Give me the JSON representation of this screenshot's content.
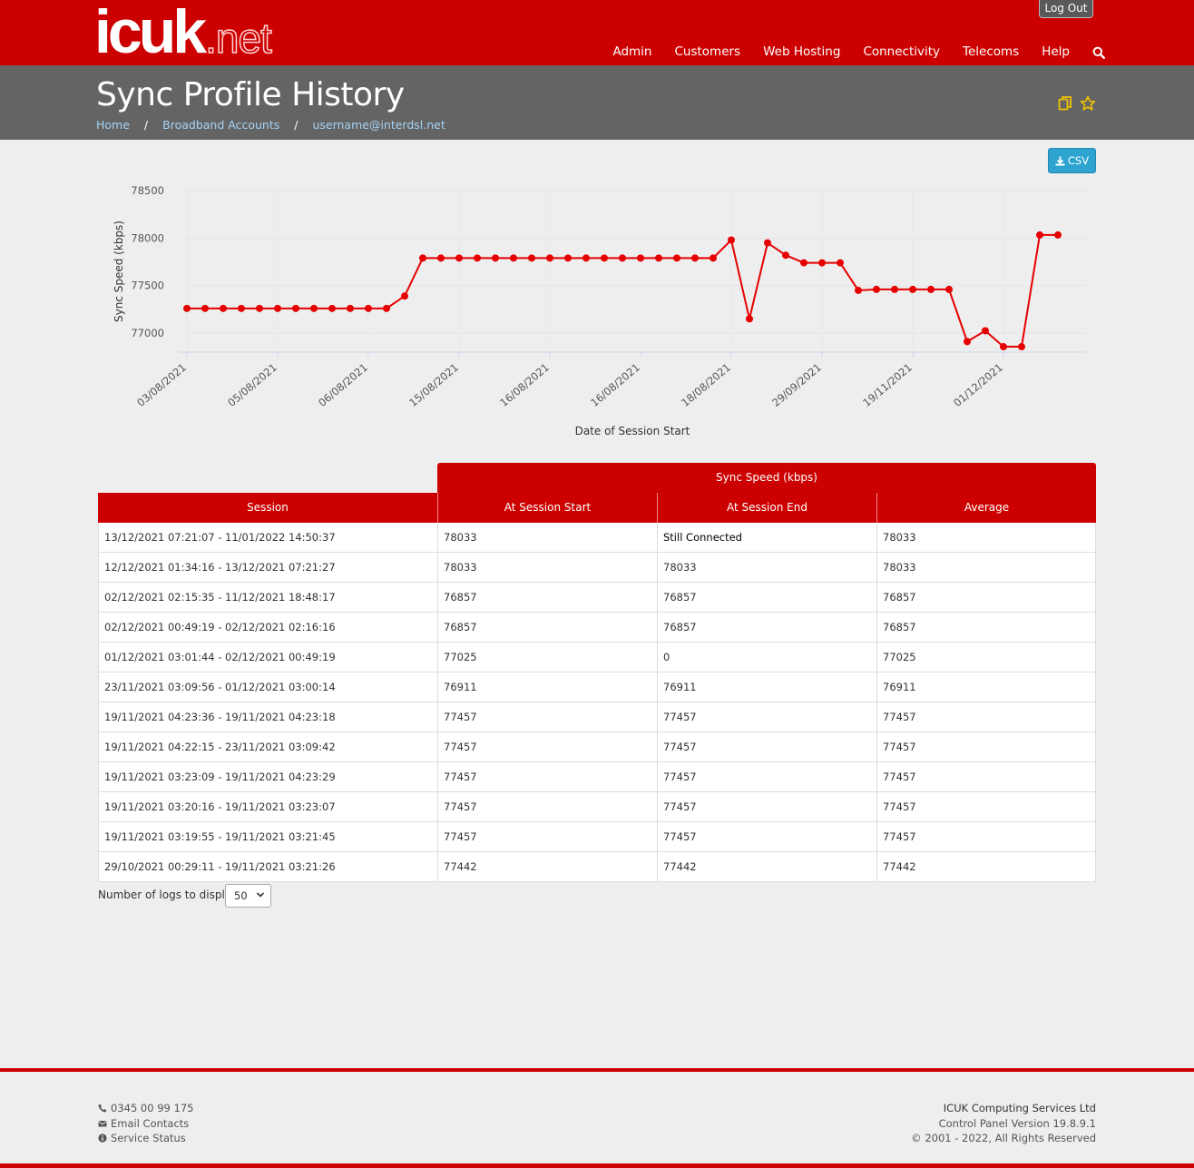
{
  "header": {
    "logo_main": "icuk",
    "logo_ext": ".net",
    "logout_label": "Log Out",
    "nav": [
      "Admin",
      "Customers",
      "Web Hosting",
      "Connectivity",
      "Telecoms",
      "Help"
    ]
  },
  "page": {
    "title": "Sync Profile History",
    "breadcrumb": [
      "Home",
      "Broadband Accounts",
      "username@interdsl.net"
    ],
    "breadcrumb_sep": "/",
    "csv_label": "CSV"
  },
  "chart_data": {
    "type": "line",
    "title": "",
    "xlabel": "Date of Session Start",
    "ylabel": "Sync Speed (kbps)",
    "ylim": [
      76800,
      78500
    ],
    "yticks": [
      77000,
      77500,
      78000,
      78500
    ],
    "xtick_labels": [
      "03/08/2021",
      "05/08/2021",
      "06/08/2021",
      "15/08/2021",
      "16/08/2021",
      "16/08/2021",
      "18/08/2021",
      "29/09/2021",
      "19/11/2021",
      "01/12/2021"
    ],
    "color": "#e60000",
    "grid": true,
    "values": [
      77260,
      77260,
      77260,
      77260,
      77260,
      77260,
      77260,
      77260,
      77260,
      77260,
      77260,
      77260,
      77390,
      77790,
      77790,
      77790,
      77790,
      77790,
      77790,
      77790,
      77790,
      77790,
      77790,
      77790,
      77790,
      77790,
      77790,
      77790,
      77790,
      77790,
      77980,
      77150,
      77950,
      77820,
      77740,
      77740,
      77740,
      77450,
      77460,
      77460,
      77460,
      77460,
      77460,
      76911,
      77025,
      76857,
      76857,
      78033,
      78033
    ]
  },
  "table": {
    "group_header": "Sync Speed (kbps)",
    "columns": [
      "Session",
      "At Session Start",
      "At Session End",
      "Average"
    ],
    "rows": [
      [
        "13/12/2021 07:21:07 - 11/01/2022 14:50:37",
        "78033",
        "Still Connected",
        "78033"
      ],
      [
        "12/12/2021 01:34:16 - 13/12/2021 07:21:27",
        "78033",
        "78033",
        "78033"
      ],
      [
        "02/12/2021 02:15:35 - 11/12/2021 18:48:17",
        "76857",
        "76857",
        "76857"
      ],
      [
        "02/12/2021 00:49:19 - 02/12/2021 02:16:16",
        "76857",
        "76857",
        "76857"
      ],
      [
        "01/12/2021 03:01:44 - 02/12/2021 00:49:19",
        "77025",
        "0",
        "77025"
      ],
      [
        "23/11/2021 03:09:56 - 01/12/2021 03:00:14",
        "76911",
        "76911",
        "76911"
      ],
      [
        "19/11/2021 04:23:36 - 19/11/2021 04:23:18",
        "77457",
        "77457",
        "77457"
      ],
      [
        "19/11/2021 04:22:15 - 23/11/2021 03:09:42",
        "77457",
        "77457",
        "77457"
      ],
      [
        "19/11/2021 03:23:09 - 19/11/2021 04:23:29",
        "77457",
        "77457",
        "77457"
      ],
      [
        "19/11/2021 03:20:16 - 19/11/2021 03:23:07",
        "77457",
        "77457",
        "77457"
      ],
      [
        "19/11/2021 03:19:55 - 19/11/2021 03:21:45",
        "77457",
        "77457",
        "77457"
      ],
      [
        "29/10/2021 00:29:11 - 19/11/2021 03:21:26",
        "77442",
        "77442",
        "77442"
      ]
    ]
  },
  "logs": {
    "label": "Number of logs to display:",
    "selected": "50"
  },
  "footer": {
    "phone": "0345 00 99 175",
    "email": "Email Contacts",
    "status": "Service Status",
    "company": "ICUK Computing Services Ltd",
    "version": "Control Panel Version 19.8.9.1",
    "copyright": "© 2001 - 2022, All Rights Reserved"
  },
  "colors": {
    "brand_red": "#cc0000",
    "title_bar": "#646464",
    "csv_button": "#2ea3cf",
    "icon_yellow": "#f2c200"
  },
  "icons": [
    "search-icon",
    "copy-icon",
    "star-icon",
    "download-icon",
    "phone-icon",
    "envelope-icon",
    "info-icon",
    "chevron-down-icon"
  ]
}
